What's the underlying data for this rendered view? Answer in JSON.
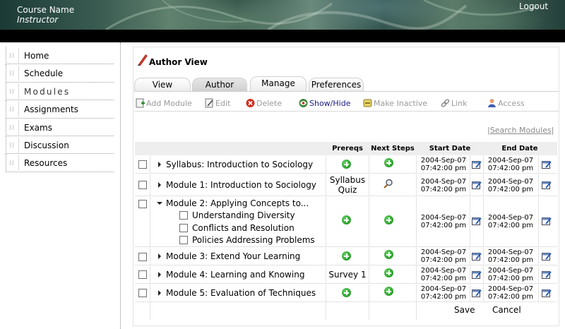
{
  "header": {
    "course_name": "Course Name",
    "role": "Instructor",
    "logout_label": "Logout"
  },
  "nav": {
    "items": [
      {
        "label": "Home"
      },
      {
        "label": "Schedule"
      },
      {
        "label": "Modules",
        "active": true
      },
      {
        "label": "Assignments"
      },
      {
        "label": "Exams"
      },
      {
        "label": "Discussion"
      },
      {
        "label": "Resources"
      }
    ]
  },
  "page_title": "Author View",
  "tabs": [
    {
      "label": "View"
    },
    {
      "label": "Author",
      "selected": true
    },
    {
      "label": "Manage"
    },
    {
      "label": "Preferences"
    }
  ],
  "toolbar": {
    "add_module": "Add Module",
    "edit": "Edit",
    "delete": "Delete",
    "show_hide": "Show/Hide",
    "make_inactive": "Make Inactive",
    "link": "Link",
    "access": "Access"
  },
  "search": {
    "separator": "|",
    "link": "Search Modules",
    "separator_end": "|"
  },
  "table": {
    "headers": {
      "prereqs": "Prereqs",
      "next_steps": "Next Steps",
      "start_date": "Start Date",
      "end_date": "End Date"
    },
    "rows": [
      {
        "title": "Syllabus: Introduction to Sociology",
        "start_date": "2004-Sep-07",
        "start_time": "07:42:00 pm",
        "end_date": "2004-Sep-07",
        "end_time": "07:42:00 pm"
      },
      {
        "title": "Module 1: Introduction to Sociology",
        "prereq_line1": "Syllabus",
        "prereq_line2": "Quiz",
        "start_date": "2004-Sep-07",
        "start_time": "07:42:00 pm",
        "end_date": "2004-Sep-07",
        "end_time": "07:42:00 pm"
      },
      {
        "title": "Module 2: Applying Concepts to...",
        "sections": [
          "Understanding Diversity",
          "Conflicts and Resolution",
          "Policies Addressing Problems"
        ],
        "start_date": "2004-Sep-07",
        "start_time": "07:42:00 pm",
        "end_date": "2004-Sep-07",
        "end_time": "07:42:00 pm"
      },
      {
        "title": "Module 3: Extend Your Learning",
        "start_date": "2004-Sep-07",
        "start_time": "07:42:00 pm",
        "end_date": "2004-Sep-07",
        "end_time": "07:42:00 pm"
      },
      {
        "title": "Module 4: Learning and Knowing",
        "prereq": "Survey 1",
        "start_date": "2004-Sep-07",
        "start_time": "07:42:00 pm",
        "end_date": "2004-Sep-07",
        "end_time": "07:42:00 pm"
      },
      {
        "title": "Module 5: Evaluation of Techniques",
        "start_date": "2004-Sep-07",
        "start_time": "07:42:00 pm",
        "end_date": "2004-Sep-07",
        "end_time": "07:42:00 pm"
      }
    ]
  },
  "actions": {
    "save": "Save",
    "cancel": "Cancel"
  },
  "colors": {
    "plus_icon": "#1e9a1e",
    "link_enabled": "#1a1a80",
    "link_disabled": "#9a9a9a",
    "header_band": "#000000"
  }
}
